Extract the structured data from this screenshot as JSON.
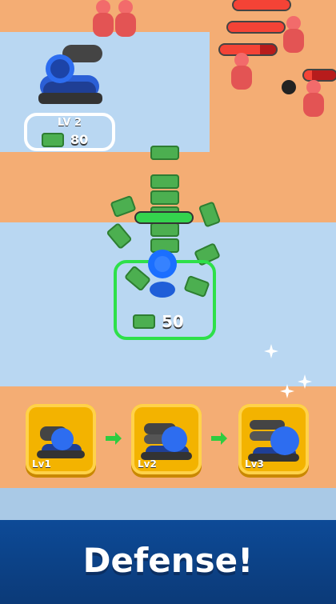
{
  "left_turret": {
    "level_label": "LV 2",
    "price": "80"
  },
  "center_pad": {
    "price": "50"
  },
  "upgrades": {
    "cards": [
      {
        "label": "Lv1"
      },
      {
        "label": "Lv2"
      },
      {
        "label": "Lv3"
      }
    ]
  },
  "banner": {
    "title": "Defense!"
  },
  "enemy_health": [
    {
      "fill": 1.0
    },
    {
      "fill": 1.0
    },
    {
      "fill": 0.72
    },
    {
      "fill": 0.25
    }
  ],
  "player_health": {
    "fill": 1.0
  },
  "colors": {
    "health_red": "#f44336",
    "health_green": "#34d34d",
    "cash_green": "#4caf50",
    "upgrade_gold": "#f3b300",
    "banner_blue": "#0f4b9a"
  }
}
